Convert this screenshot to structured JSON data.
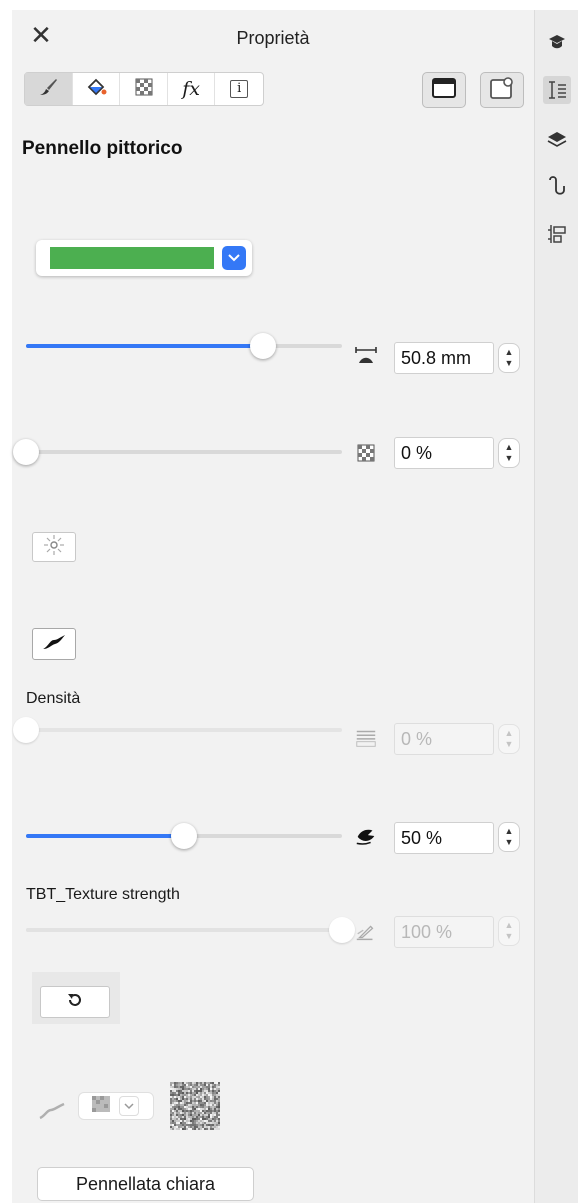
{
  "window": {
    "title": "Proprietà",
    "close_glyph": "✕"
  },
  "tabs": [
    {
      "icon": "paintbrush-icon",
      "active": true
    },
    {
      "icon": "fill-bucket-icon",
      "active": false
    },
    {
      "icon": "transparency-icon",
      "active": false
    },
    {
      "icon": "fx-icon",
      "label": "fx",
      "active": false
    },
    {
      "icon": "info-icon",
      "label": "i",
      "active": false
    }
  ],
  "view_buttons": [
    {
      "icon": "window-icon"
    },
    {
      "icon": "window-pin-icon"
    }
  ],
  "section_title": "Pennello pittorico",
  "color": {
    "value": "#4caf50",
    "accent": "#3478f6"
  },
  "size": {
    "value": "50.8 mm",
    "level": 0.75
  },
  "transparency": {
    "value": "0 %",
    "level": 0.0
  },
  "density": {
    "label": "Densità",
    "value": "0 %",
    "level": 0.0,
    "enabled": false
  },
  "smoothing": {
    "value": "50 %",
    "level": 0.5
  },
  "texture_strength": {
    "label": "TBT_Texture strength",
    "value": "100 %",
    "level": 1.0,
    "enabled": false
  },
  "bottom_button": "Pennellata chiara",
  "side_toolbar": [
    "hint-hat-icon",
    "properties-icon",
    "layers-icon",
    "curve-icon",
    "align-icon"
  ]
}
